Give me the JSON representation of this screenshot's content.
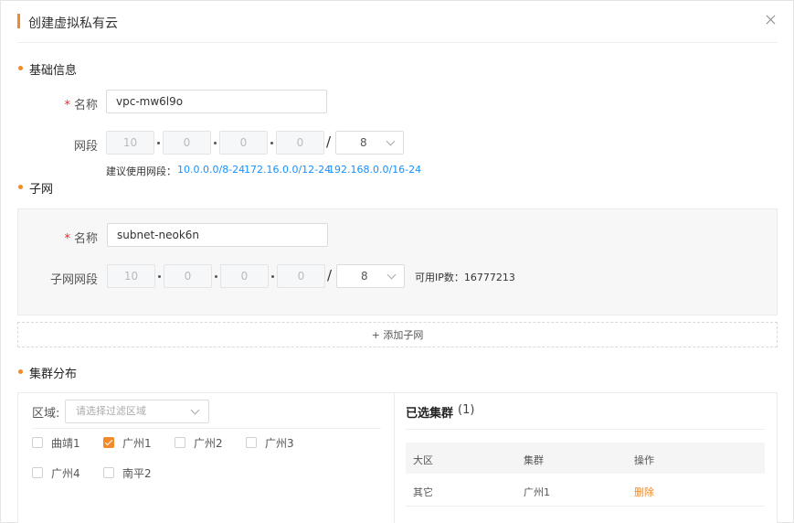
{
  "dialog": {
    "title": "创建虚拟私有云"
  },
  "basic": {
    "section_title": "基础信息",
    "name_label": "名称",
    "required_mark": "*",
    "name_value": "vpc-mw6l9o",
    "cidr_label": "网段",
    "cidr_octets": [
      "10",
      "0",
      "0",
      "0"
    ],
    "slash": "/",
    "mask_value": "8",
    "suggest_label": "建议使用网段：",
    "suggest_links": [
      "10.0.0.0/8-24",
      "172.16.0.0/12-24",
      "192.168.0.0/16-24"
    ]
  },
  "subnet": {
    "section_title": "子网",
    "name_label": "名称",
    "name_value": "subnet-neok6n",
    "cidr_label": "子网网段",
    "cidr_octets": [
      "10",
      "0",
      "0",
      "0"
    ],
    "mask_value": "8",
    "available_ip": "可用IP数：16777213",
    "add_button": "+ 添加子网"
  },
  "cluster": {
    "section_title": "集群分布",
    "region_label": "区域:",
    "region_placeholder": "请选择过滤区域",
    "options": [
      {
        "label": "曲靖1",
        "checked": false
      },
      {
        "label": "广州1",
        "checked": true
      },
      {
        "label": "广州2",
        "checked": false
      },
      {
        "label": "广州3",
        "checked": false
      },
      {
        "label": "广州4",
        "checked": false
      },
      {
        "label": "南平2",
        "checked": false
      }
    ],
    "selected_title": "已选集群",
    "selected_count": "(1)",
    "table_headers": [
      "大区",
      "集群",
      "操作"
    ],
    "rows": [
      {
        "region": "其它",
        "cluster": "广州1",
        "action": "删除"
      }
    ]
  },
  "colors": {
    "accent": "#f08a2b",
    "link": "#1890ff",
    "required": "#f5222d"
  }
}
